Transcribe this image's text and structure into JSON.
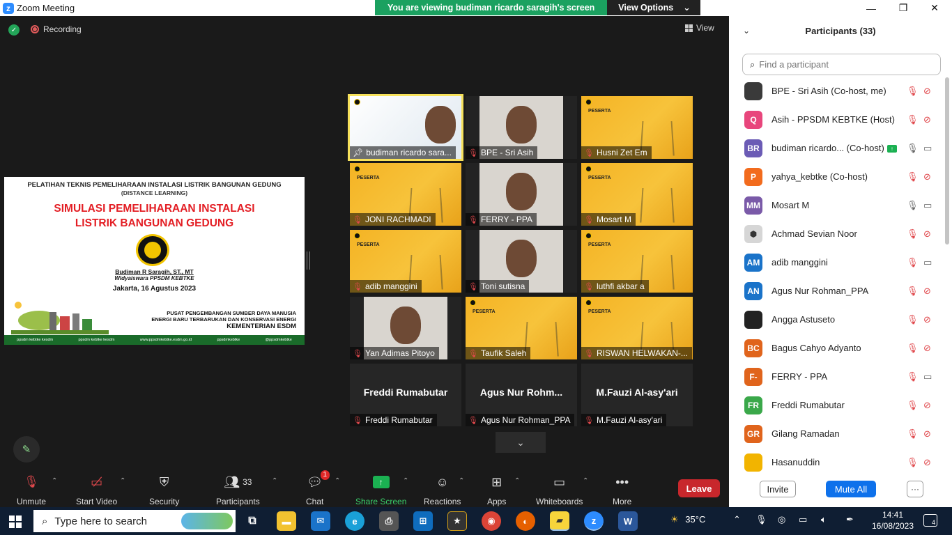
{
  "window": {
    "title": "Zoom Meeting",
    "banner_text": "You are viewing budiman ricardo saragih's screen",
    "banner_button": "View Options"
  },
  "meeting": {
    "recording_label": "Recording",
    "view_label": "View"
  },
  "slide": {
    "header": "PELATIHAN TEKNIS PEMELIHARAAN INSTALASI LISTRIK BANGUNAN GEDUNG",
    "subheader": "(DISTANCE LEARNING)",
    "title_line1": "SIMULASI PEMELIHARAAN INSTALASI",
    "title_line2": "LISTRIK BANGUNAN GEDUNG",
    "presenter": "Budiman R Saragih, ST., MT",
    "role": "Widyaiswara PPSDM KEBTKE",
    "place_date": "Jakarta, 16 Agustus 2023",
    "org1": "PUSAT PENGEMBANGAN SUMBER DAYA MANUSIA",
    "org2": "ENERGI BARU TERBARUKAN DAN KONSERVASI ENERGI",
    "org3": "KEMENTERIAN ESDM",
    "footer": [
      "ppsdm kebtke kesdm",
      "ppsdm kebtke kesdm",
      "www.ppsdmkebtke.esdm.go.id",
      "ppsdmkebtke",
      "@ppsdmkebtke"
    ]
  },
  "gallery": [
    {
      "name": "budiman ricardo sara...",
      "type": "screen",
      "active": true
    },
    {
      "name": "BPE - Sri Asih",
      "type": "video"
    },
    {
      "name": "Husni Zet Em",
      "type": "poster"
    },
    {
      "name": "JONI RACHMADI",
      "type": "poster"
    },
    {
      "name": "FERRY - PPA",
      "type": "video"
    },
    {
      "name": "Mosart M",
      "type": "poster"
    },
    {
      "name": "adib manggini",
      "type": "poster"
    },
    {
      "name": "Toni sutisna",
      "type": "video"
    },
    {
      "name": "luthfi akbar a",
      "type": "poster"
    },
    {
      "name": "Yan Adimas Pitoyo",
      "type": "video"
    },
    {
      "name": "Taufik Saleh",
      "type": "poster"
    },
    {
      "name": "RISWAN HELWAKAN-...",
      "type": "poster"
    },
    {
      "name": "Freddi Rumabutar",
      "type": "blank",
      "big": "Freddi Rumabutar"
    },
    {
      "name": "Agus Nur Rohman_PPA",
      "type": "blank",
      "big": "Agus Nur Rohm..."
    },
    {
      "name": "M.Fauzi Al-asy'ari",
      "type": "blank",
      "big": "M.Fauzi Al-asy'ari"
    }
  ],
  "poster_label": "PESERTA",
  "toolbar": {
    "unmute": "Unmute",
    "start_video": "Start Video",
    "security": "Security",
    "participants": "Participants",
    "participants_count": "33",
    "chat": "Chat",
    "chat_badge": "1",
    "share_screen": "Share Screen",
    "reactions": "Reactions",
    "apps": "Apps",
    "whiteboards": "Whiteboards",
    "more": "More",
    "leave": "Leave"
  },
  "panel": {
    "title": "Participants (33)",
    "search_placeholder": "Find a participant",
    "invite": "Invite",
    "mute_all": "Mute All",
    "more": "···"
  },
  "participants": [
    {
      "initials": "",
      "name": "BPE - Sri Asih (Co-host, me)",
      "color": "#3a3a3a",
      "mic": "off",
      "cam": "off"
    },
    {
      "initials": "Q",
      "name": "Asih - PPSDM KEBTKE (Host)",
      "color": "#e8467c",
      "mic": "off",
      "cam": "off"
    },
    {
      "initials": "BR",
      "name": "budiman ricardo... (Co-host)",
      "color": "#6b5bb5",
      "mic": "on",
      "cam": "on",
      "sharing": true
    },
    {
      "initials": "P",
      "name": "yahya_kebtke (Co-host)",
      "color": "#f26b1d",
      "mic": "off",
      "cam": "off"
    },
    {
      "initials": "MM",
      "name": "Mosart M",
      "color": "#7a5aa8",
      "mic": "on",
      "cam": "on"
    },
    {
      "initials": "",
      "name": "Achmad Sevian Noor",
      "color": "#d6d6d6",
      "mic": "off",
      "cam": "off"
    },
    {
      "initials": "AM",
      "name": "adib manggini",
      "color": "#1a73c9",
      "mic": "off",
      "cam": "on"
    },
    {
      "initials": "AN",
      "name": "Agus Nur Rohman_PPA",
      "color": "#1a73c9",
      "mic": "off",
      "cam": "off"
    },
    {
      "initials": "",
      "name": "Angga Astuseto",
      "color": "#222222",
      "mic": "off",
      "cam": "off"
    },
    {
      "initials": "BC",
      "name": "Bagus Cahyo Adyanto",
      "color": "#e0641c",
      "mic": "off",
      "cam": "off"
    },
    {
      "initials": "F-",
      "name": "FERRY - PPA",
      "color": "#e0641c",
      "mic": "off",
      "cam": "on"
    },
    {
      "initials": "FR",
      "name": "Freddi Rumabutar",
      "color": "#3aa84a",
      "mic": "off",
      "cam": "off"
    },
    {
      "initials": "GR",
      "name": "Gilang Ramadan",
      "color": "#e0641c",
      "mic": "off",
      "cam": "off"
    },
    {
      "initials": "",
      "name": "Hasanuddin",
      "color": "#f2b400",
      "mic": "off",
      "cam": "off"
    }
  ],
  "taskbar": {
    "search_placeholder": "Type here to search",
    "weather": "35°C",
    "time": "14:41",
    "date": "16/08/2023",
    "notifications": "4"
  }
}
